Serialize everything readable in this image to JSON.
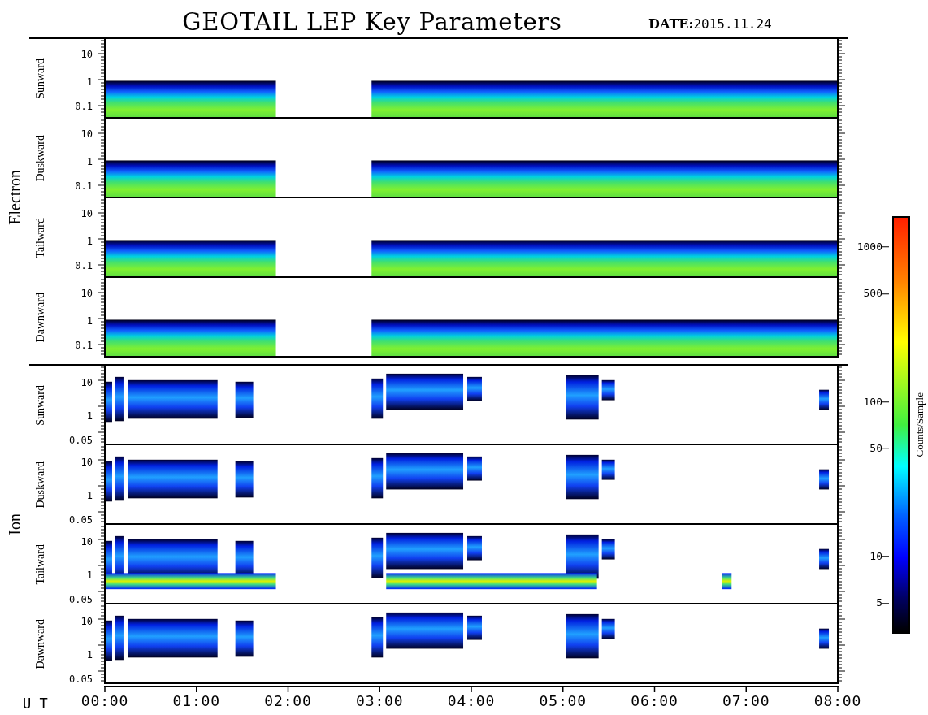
{
  "title": "GEOTAIL LEP Key Parameters",
  "date": {
    "label": "DATE:",
    "value": "2015.11.24"
  },
  "groups": [
    {
      "name": "Electron",
      "kind": "electron",
      "panels": [
        {
          "label": "Sunward",
          "yticks": [
            "10",
            "1",
            "0.1"
          ]
        },
        {
          "label": "Duskward",
          "yticks": [
            "10",
            "1",
            "0.1"
          ]
        },
        {
          "label": "Tailward",
          "yticks": [
            "10",
            "1",
            "0.1"
          ]
        },
        {
          "label": "Dawnward",
          "yticks": [
            "10",
            "1",
            "0.1"
          ]
        }
      ]
    },
    {
      "name": "Ion",
      "kind": "ion",
      "panels": [
        {
          "label": "Sunward",
          "yticks": [
            "10",
            "1",
            "0.05"
          ]
        },
        {
          "label": "Duskward",
          "yticks": [
            "10",
            "1",
            "0.05"
          ]
        },
        {
          "label": "Tailward",
          "yticks": [
            "10",
            "1",
            "0.05"
          ]
        },
        {
          "label": "Dawnward",
          "yticks": [
            "10",
            "1",
            "0.05"
          ]
        }
      ]
    }
  ],
  "time_axis": {
    "label": "U T",
    "ticks": [
      "00:00",
      "01:00",
      "02:00",
      "03:00",
      "04:00",
      "05:00",
      "06:00",
      "07:00",
      "08:00"
    ]
  },
  "colorbar": {
    "title": "Counts/Sample",
    "ticks": [
      "1000",
      "500",
      "100",
      "50",
      "10",
      "5"
    ]
  }
}
